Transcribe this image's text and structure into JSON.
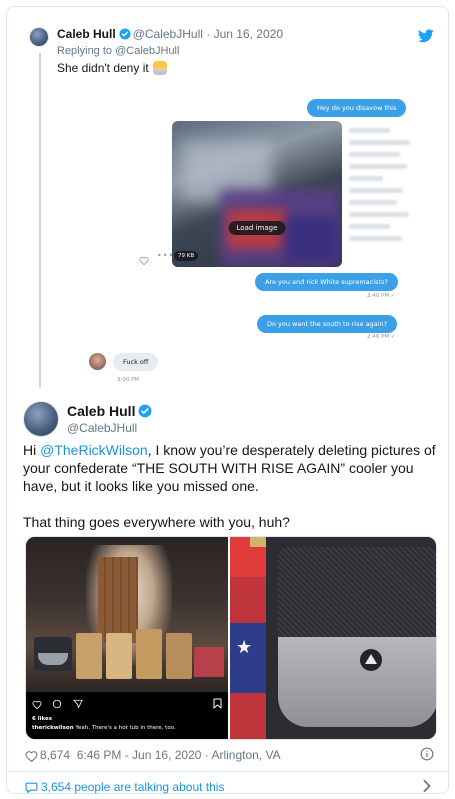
{
  "reply_tweet": {
    "name": "Caleb Hull",
    "handle": "@CalebJHull",
    "separator": "·",
    "date": "Jun 16, 2020",
    "replying_to": "Replying to @CalebJHull",
    "text": "She didn't deny it"
  },
  "dm": {
    "msg1": "Hey do you disavow this",
    "load_image": "Load image",
    "file_size": "79 KB",
    "msg2": "Are you and rick White supremacists?",
    "time2": "2:40 PM ✓",
    "msg3": "Do you want the south to rise again?",
    "time3": "2:46 PM ✓",
    "reply": "Fuck off",
    "time_reply": "3:00 PM"
  },
  "main_tweet": {
    "name": "Caleb Hull",
    "handle": "@CalebJHull",
    "text_pre": "Hi ",
    "mention": "@TheRickWilson",
    "text_post": ", I know you’re desperately deleting pictures of your confederate “THE SOUTH WITH RISE AGAIN” cooler you have, but it looks like you missed one.",
    "text2": "That thing goes everywhere with you, huh?"
  },
  "instagram": {
    "likes": "6 likes",
    "user": "therickwilson",
    "caption": " Yeah. There's a hot tub in there, too."
  },
  "meta": {
    "likes": "8,674",
    "time": "6:46 PM - Jun 16, 2020 · Arlington, VA"
  },
  "footer": {
    "talking": "3,654 people are talking about this"
  },
  "colors": {
    "twitter_blue": "#1da1f2",
    "link_blue": "#1b95e0",
    "dm_bubble": "#3ca0e8",
    "text_dark": "#14171a",
    "text_muted": "#657786"
  },
  "icons": [
    "verified-icon",
    "twitter-bird-icon",
    "heart-icon",
    "info-icon",
    "comment-bubble-icon",
    "chevron-right-icon"
  ]
}
